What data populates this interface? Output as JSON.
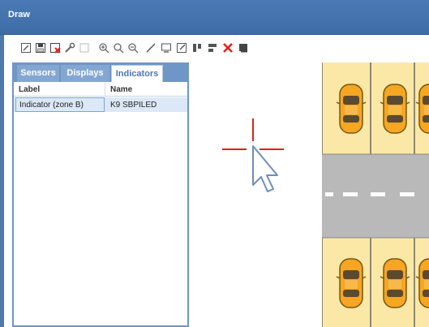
{
  "window": {
    "title": "Draw"
  },
  "toolbar": {
    "tools": [
      {
        "name": "select-icon"
      },
      {
        "name": "save-icon"
      },
      {
        "name": "delete-item-icon"
      },
      {
        "name": "wrench-icon"
      },
      {
        "name": "rectangle-icon"
      },
      {
        "name": "zoom-in-icon"
      },
      {
        "name": "zoom-icon"
      },
      {
        "name": "zoom-out-icon"
      },
      {
        "name": "line-icon"
      },
      {
        "name": "display-icon"
      },
      {
        "name": "edit-icon"
      },
      {
        "name": "align-vertical-icon"
      },
      {
        "name": "align-horizontal-icon"
      },
      {
        "name": "close-icon"
      },
      {
        "name": "layer-icon"
      }
    ]
  },
  "tabs": {
    "sensors": "Sensors",
    "displays": "Displays",
    "indicators": "Indicators"
  },
  "table": {
    "headers": {
      "label": "Label",
      "name": "Name"
    },
    "rows": [
      {
        "label": "Indicator (zone B)",
        "name": "K9 SBPILED"
      }
    ]
  },
  "colors": {
    "accent": "#4f79ad",
    "crosshair": "#e0201a",
    "parking_bg": "#fbe8a6",
    "road": "#b9b9b9",
    "car": "#f5a623"
  }
}
